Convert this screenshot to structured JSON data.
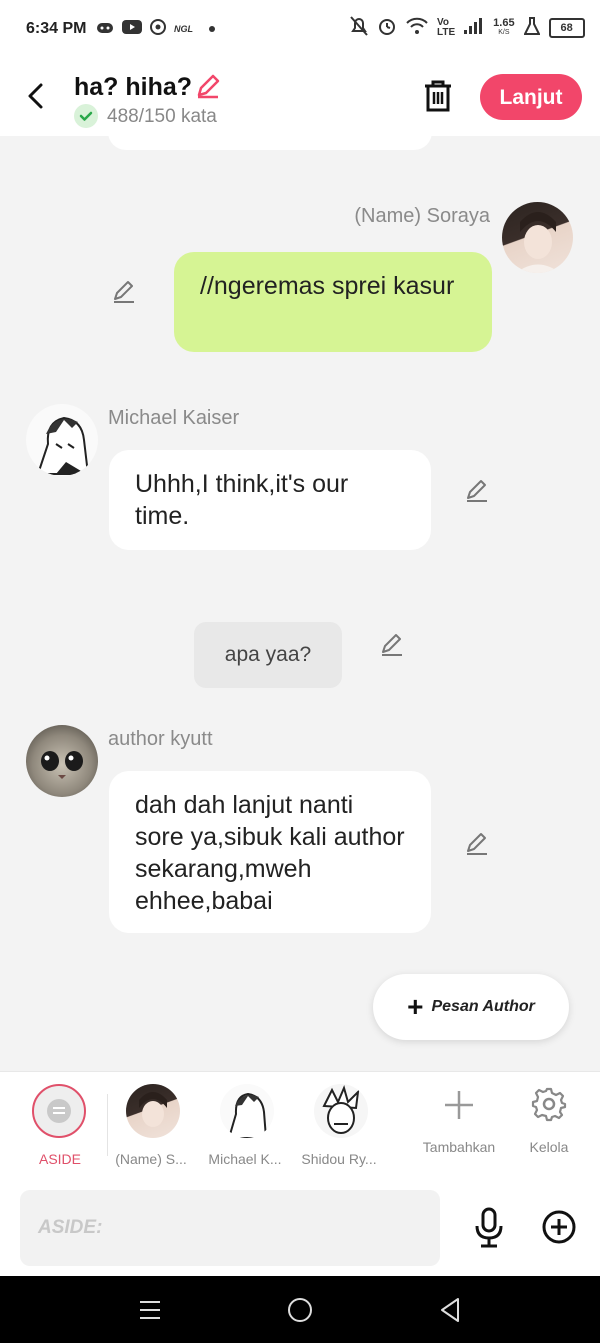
{
  "status_bar": {
    "time": "6:34 PM",
    "left_icons": [
      "gamepad-icon",
      "youtube-icon",
      "whatsapp-icon",
      "ngl-icon",
      "dot-icon"
    ],
    "ngl_text": "NGL",
    "volte_text": "Vo\nLTE",
    "speed_value": "1.65",
    "speed_unit": "K/S",
    "battery": "68"
  },
  "header": {
    "title": "ha? hiha?",
    "word_count": "488/150 kata",
    "next_button": "Lanjut"
  },
  "messages": [
    {
      "speaker": "(Name) Soraya",
      "text": "//ngeremas sprei kasur",
      "side": "right"
    },
    {
      "speaker": "Michael Kaiser",
      "text": "Uhhh,I think,it's our time.",
      "side": "left"
    },
    {
      "narration": "apa yaa?"
    },
    {
      "speaker": "author kyutt",
      "text": "dah dah lanjut nanti sore ya,sibuk kali author sekarang,mweh ehhee,babai",
      "side": "left"
    }
  ],
  "author_message_button": "Pesan Author",
  "characters": [
    {
      "label": "ASIDE",
      "selected": true
    },
    {
      "label": "(Name) S..."
    },
    {
      "label": "Michael K..."
    },
    {
      "label": "Shidou Ry..."
    }
  ],
  "add_label": "Tambahkan",
  "manage_label": "Kelola",
  "input": {
    "placeholder": "ASIDE:"
  },
  "colors": {
    "accent": "#f2466a",
    "green_bubble": "#d6f494",
    "selected_ring": "#e0506a"
  }
}
